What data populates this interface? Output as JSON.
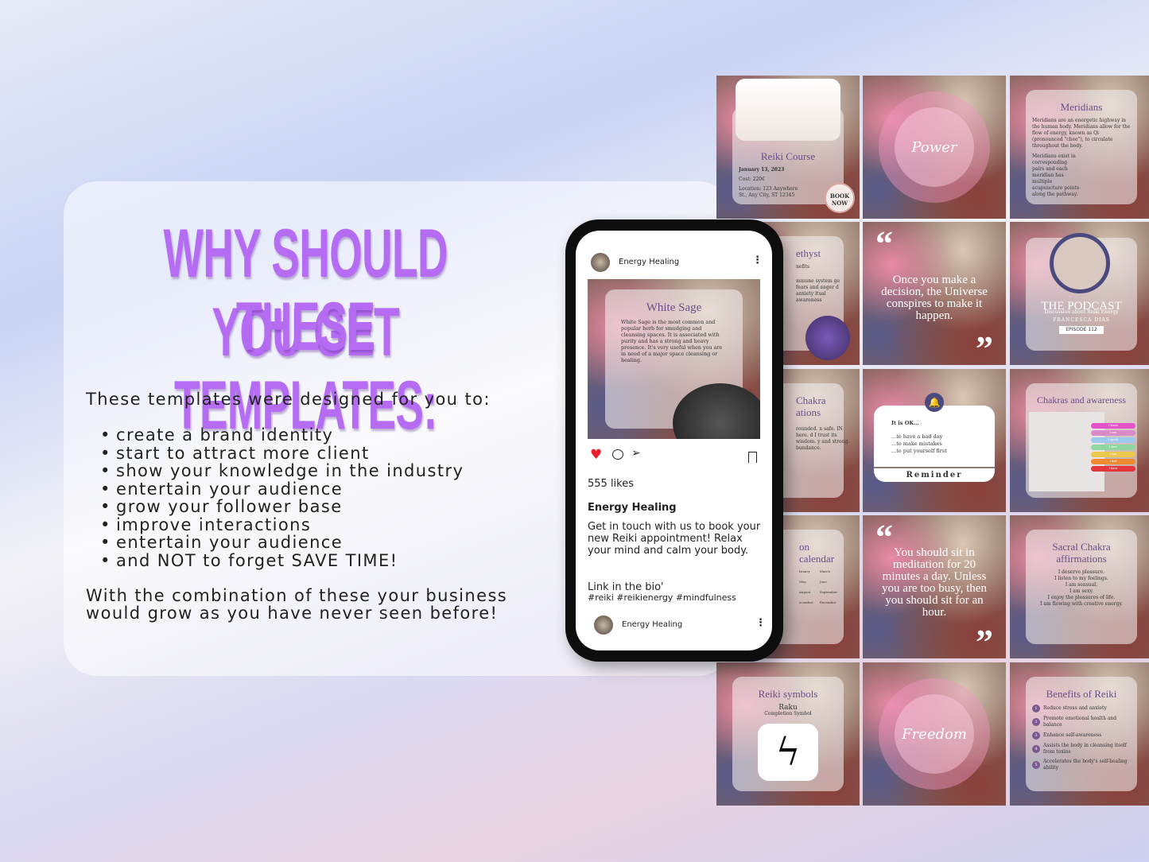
{
  "headline": {
    "line1": "WHY SHOULD YOU GET",
    "line2": "THESE TEMPLATES:"
  },
  "intro": "These templates were designed for you to:",
  "bullets": [
    "create a brand identity",
    "start to attract more client",
    "show your knowledge in the industry",
    "entertain your audience",
    "grow your follower base",
    "improve interactions",
    "entertain your audience",
    "and NOT to forget SAVE TIME!"
  ],
  "closing": {
    "line1": "With the combination of these your business",
    "line2": "would grow as you have never seen before!"
  },
  "phone": {
    "account": "Energy Healing",
    "post_title": "White Sage",
    "post_body": "White Sage is the most common and popular herb for smudging and cleansing spaces. It is associated with purity and has a strong and heavy presence. It's very useful when you are in need of a major space cleansing or healing.",
    "likes": "555 likes",
    "caption_title": "Energy Healing",
    "caption": "Get in touch with us to book your new Reiki appointment! Relax your mind and calm your body.",
    "link": "Link in the bio'",
    "hashtags": "#reiki #reikienergy #mindfulness",
    "next_account": "Energy Healing",
    "like_color": "#e8202a"
  },
  "tiles": {
    "reiki_course": {
      "title": "Reiki Course",
      "date": "January 13, 2023",
      "cost": "Cost: 220€",
      "location": "Location: 123 Anywhere St., Any City, ST 12345",
      "cta": "BOOK NOW"
    },
    "power": "Power",
    "meridians": {
      "title": "Meridians",
      "p1": "Meridians are an energetic highway in the human body. Meridians allow for the flow of energy, known as Qi (pronounced \"chee\"), to circulate throughout the body.",
      "p2": "Meridians exist in corresponding pairs and each meridian has multiple acupuncture points along the pathway."
    },
    "amethyst": {
      "title": "ethyst",
      "sub": "nefits",
      "lines": "mmune system ge fears and anger d anxiety itual awareness"
    },
    "quote1": "Once you make a decision, the Universe conspires to make it happen.",
    "podcast": {
      "title": "THE PODCAST",
      "sub": "Discussion about Reiki Energy",
      "host": "FRANCESCA DIAS",
      "episode": "EPISODE 112"
    },
    "chakra_aff": {
      "title": "Chakra\nations",
      "lines": "rounded. n safe. IN here. d I trust its wisdom. y and strong. bundance."
    },
    "reminder": {
      "lead": "It is OK...",
      "lines": [
        "...to have a bad day",
        "...to make mistakes",
        "...to put yourself first"
      ],
      "label": "Reminder"
    },
    "chakras": {
      "title": "Chakras and awareness",
      "labels": [
        "I know",
        "I see",
        "I speak",
        "I love",
        "I can",
        "I feel",
        "I have"
      ],
      "colors": [
        "#e254c8",
        "#d98ac9",
        "#9ec9ee",
        "#8fd6a1",
        "#ecc84e",
        "#f08a2e",
        "#e2363d"
      ]
    },
    "calendar": {
      "title": "on calendar",
      "months": [
        "bruary",
        "March",
        "May",
        "June",
        "August",
        "September",
        "ecember",
        "December"
      ]
    },
    "quote2": "You should sit in meditation for 20 minutes a day. Unless you are too busy, then you should sit for an hour.",
    "sacral": {
      "title": "Sacral Chakra affirmations",
      "lines": [
        "I deserve pleasure.",
        "I listen to my feelings.",
        "I am sensual.",
        "I am sexy.",
        "I enjoy the pleasures of life.",
        "I am flowing with creative energy."
      ]
    },
    "symbols": {
      "title": "Reiki symbols",
      "name": "Raku",
      "sub": "Completion Symbol"
    },
    "freedom": "Freedom",
    "benefits": {
      "title": "Benefits of Reiki",
      "items": [
        "Reduce stress and anxiety",
        "Promote emotional health and balance",
        "Enhance self-awareness",
        "Assists the body in cleansing itself from toxins",
        "Accelerates the body's self-healing ability"
      ]
    }
  }
}
